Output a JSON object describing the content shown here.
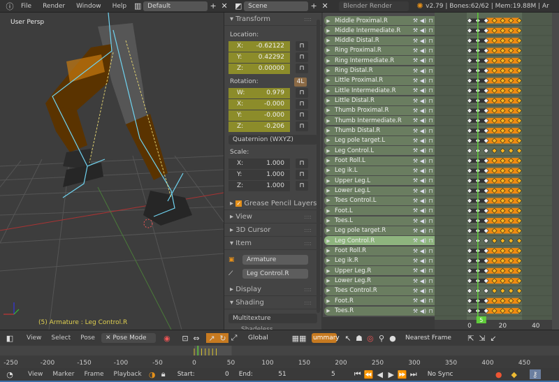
{
  "topbar": {
    "menus": [
      "File",
      "Render",
      "Window",
      "Help"
    ],
    "layout": "Default",
    "scene": "Scene",
    "engine": "Blender Render",
    "status": "v2.79 | Bones:62/62 | Mem:19.88M | Ar"
  },
  "viewport": {
    "view_label": "User Persp",
    "object_info": "(5) Armature : Leg Control.R"
  },
  "properties": {
    "transform_title": "Transform",
    "location_label": "Location:",
    "location": [
      {
        "axis": "X:",
        "value": "-0.62122"
      },
      {
        "axis": "Y:",
        "value": "0.42292"
      },
      {
        "axis": "Z:",
        "value": "0.00000"
      }
    ],
    "rotation_label": "Rotation:",
    "rotation_lock_badge": "4L",
    "rotation": [
      {
        "axis": "W:",
        "value": "0.979"
      },
      {
        "axis": "X:",
        "value": "-0.000"
      },
      {
        "axis": "Y:",
        "value": "-0.000"
      },
      {
        "axis": "Z:",
        "value": "-0.206"
      }
    ],
    "rotation_mode": "Quaternion (WXYZ)",
    "scale_label": "Scale:",
    "scale": [
      {
        "axis": "X:",
        "value": "1.000"
      },
      {
        "axis": "Y:",
        "value": "1.000"
      },
      {
        "axis": "Z:",
        "value": "1.000"
      }
    ],
    "panels": {
      "grease": "Grease Pencil Layers",
      "view": "View",
      "cursor": "3D Cursor",
      "item": "Item",
      "display": "Display",
      "shading": "Shading"
    },
    "item_object": "Armature",
    "item_bone": "Leg Control.R",
    "shading_mode": "Multitexture",
    "shadeless": "Shadeless"
  },
  "dopesheet": {
    "current_frame": 5,
    "channels": [
      {
        "name": "Middle Proximal.R",
        "hold": true
      },
      {
        "name": "Middle Intermediate.R",
        "hold": true
      },
      {
        "name": "Middle Distal.R",
        "hold": true
      },
      {
        "name": "Ring Proximal.R",
        "hold": true
      },
      {
        "name": "Ring Intermediate.R",
        "hold": true
      },
      {
        "name": "Ring Distal.R",
        "hold": true
      },
      {
        "name": "Little Proximal.R",
        "hold": true
      },
      {
        "name": "Little Intermediate.R",
        "hold": true
      },
      {
        "name": "Little Distal.R",
        "hold": true
      },
      {
        "name": "Thumb Proximal.R",
        "hold": true
      },
      {
        "name": "Thumb Intermediate.R",
        "hold": true
      },
      {
        "name": "Thumb Distal.R",
        "hold": true
      },
      {
        "name": "Leg pole target.L",
        "hold": true
      },
      {
        "name": "Leg Control.L",
        "hold": false
      },
      {
        "name": "Foot Roll.L",
        "hold": true
      },
      {
        "name": "Leg ik.L",
        "hold": true
      },
      {
        "name": "Upper Leg.L",
        "hold": true
      },
      {
        "name": "Lower Leg.L",
        "hold": true
      },
      {
        "name": "Toes Control.L",
        "hold": true
      },
      {
        "name": "Foot.L",
        "hold": true
      },
      {
        "name": "Toes.L",
        "hold": true
      },
      {
        "name": "Leg pole target.R",
        "hold": true
      },
      {
        "name": "Leg Control.R",
        "hold": false,
        "selected": true
      },
      {
        "name": "Foot Roll.R",
        "hold": true
      },
      {
        "name": "Leg ik.R",
        "hold": true
      },
      {
        "name": "Upper Leg.R",
        "hold": true
      },
      {
        "name": "Lower Leg.R",
        "hold": true
      },
      {
        "name": "Toes Control.R",
        "hold": false
      },
      {
        "name": "Foot.R",
        "hold": true
      },
      {
        "name": "Toes.R",
        "hold": true
      }
    ],
    "key_frames_unselected": [
      0,
      5,
      10
    ],
    "key_frames_selected": [
      15,
      20,
      25,
      30
    ],
    "ruler": [
      "0",
      "20",
      "40"
    ]
  },
  "header3d": {
    "menus": [
      "View",
      "Select",
      "Pose"
    ],
    "mode": "Pose Mode",
    "orientation": "Global",
    "summary": "ummary",
    "snap": "Nearest Frame"
  },
  "timeline": {
    "ruler": [
      "-250",
      "-200",
      "-150",
      "-100",
      "-50",
      "0",
      "50",
      "100",
      "150",
      "200",
      "250",
      "300",
      "350",
      "400",
      "450"
    ],
    "menus": [
      "View",
      "Marker",
      "Frame",
      "Playback"
    ],
    "start_label": "Start:",
    "start": "0",
    "end_label": "End:",
    "end": "51",
    "current": "5",
    "sync": "No Sync"
  },
  "colors": {
    "accent": "#e5901a",
    "selected_channel": "#8eb47e",
    "playhead": "#5fcc3a"
  }
}
